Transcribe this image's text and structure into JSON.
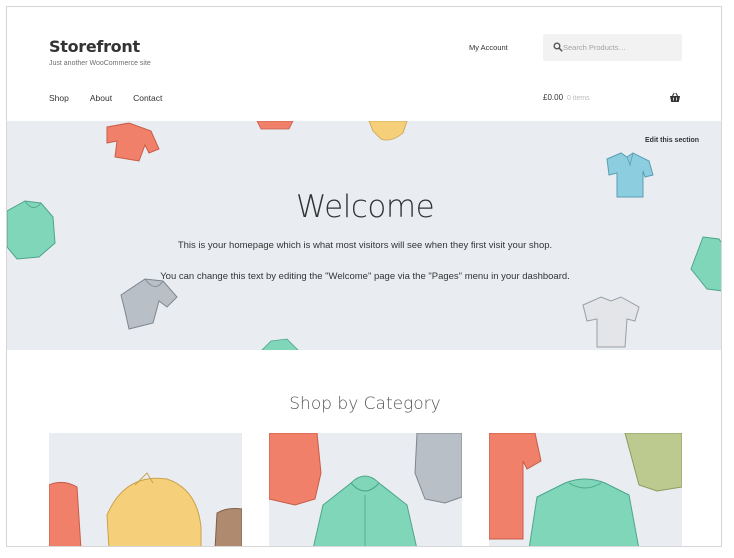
{
  "header": {
    "site_title": "Storefront",
    "tagline": "Just another WooCommerce site",
    "my_account": "My Account",
    "search_placeholder": "Search Products…"
  },
  "nav": {
    "items": [
      {
        "label": "Shop"
      },
      {
        "label": "About"
      },
      {
        "label": "Contact"
      }
    ]
  },
  "cart": {
    "total": "£0.00",
    "items": "0 items"
  },
  "hero": {
    "edit_link": "Edit this section",
    "title": "Welcome",
    "line1": "This is your homepage which is what most visitors will see when they first visit your shop.",
    "line2": "You can change this text by editing the \"Welcome\" page via the \"Pages\" menu in your dashboard."
  },
  "categories": {
    "title": "Shop by Category"
  },
  "colors": {
    "hero_bg": "#e9edf2",
    "coral": "#f0806a",
    "mint": "#7fd6b8",
    "yellow": "#f5cf7a",
    "sky": "#8ccde0",
    "grey": "#b9bfc7",
    "olive": "#bcc98f"
  }
}
